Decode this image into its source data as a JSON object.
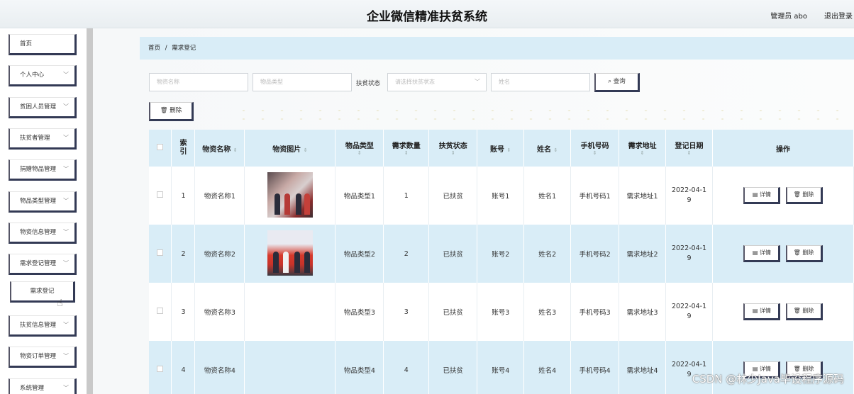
{
  "header": {
    "title": "企业微信精准扶贫系统",
    "user": "管理员 abo",
    "logout": "退出登录"
  },
  "sidebar": {
    "items": [
      {
        "label": "首页",
        "has_chevron": false
      },
      {
        "label": "个人中心",
        "has_chevron": true
      },
      {
        "label": "贫困人员管理",
        "has_chevron": true
      },
      {
        "label": "扶贫者管理",
        "has_chevron": true
      },
      {
        "label": "捐赠物品管理",
        "has_chevron": true
      },
      {
        "label": "物品类型管理",
        "has_chevron": true
      },
      {
        "label": "物资信息管理",
        "has_chevron": true
      },
      {
        "label": "需求登记管理",
        "has_chevron": true
      },
      {
        "label": "需求登记",
        "has_chevron": false
      },
      {
        "label": "扶贫信息管理",
        "has_chevron": true
      },
      {
        "label": "物资订单管理",
        "has_chevron": true
      },
      {
        "label": "系统管理",
        "has_chevron": true
      }
    ],
    "chevron": "﹀"
  },
  "breadcrumb": {
    "home": "首页",
    "separator": "/",
    "current": "需求登记"
  },
  "search": {
    "name_placeholder": "物资名称",
    "type_placeholder": "物品类型",
    "status_label": "扶贫状态",
    "status_placeholder": "请选择扶贫状态",
    "person_placeholder": "姓名",
    "search_button": "查询",
    "search_icon": "⌕"
  },
  "toolbar": {
    "delete_button": "删除",
    "delete_icon": "🗑"
  },
  "table": {
    "columns": [
      "索引",
      "物资名称",
      "物资图片",
      "物品类型",
      "需求数量",
      "扶贫状态",
      "账号",
      "姓名",
      "手机号码",
      "需求地址",
      "登记日期",
      "操作"
    ],
    "sort_icon": "⇕",
    "rows": [
      {
        "index": "1",
        "name": "物资名称1",
        "type": "物品类型1",
        "qty": "1",
        "status": "已扶贫",
        "account": "账号1",
        "person": "姓名1",
        "phone": "手机号码1",
        "address": "需求地址1",
        "date_a": "2022-04-1",
        "date_b": "9",
        "has_image": true
      },
      {
        "index": "2",
        "name": "物资名称2",
        "type": "物品类型2",
        "qty": "2",
        "status": "已扶贫",
        "account": "账号2",
        "person": "姓名2",
        "phone": "手机号码2",
        "address": "需求地址2",
        "date_a": "2022-04-1",
        "date_b": "9",
        "has_image": true
      },
      {
        "index": "3",
        "name": "物资名称3",
        "type": "物品类型3",
        "qty": "3",
        "status": "已扶贫",
        "account": "账号3",
        "person": "姓名3",
        "phone": "手机号码3",
        "address": "需求地址3",
        "date_a": "2022-04-1",
        "date_b": "9",
        "has_image": false
      },
      {
        "index": "4",
        "name": "物资名称4",
        "type": "物品类型4",
        "qty": "4",
        "status": "已扶贫",
        "account": "账号4",
        "person": "姓名4",
        "phone": "手机号码4",
        "address": "需求地址4",
        "date_a": "2022-04-1",
        "date_b": "9",
        "has_image": false
      }
    ],
    "detail_button": "详情",
    "delete_button": "删除",
    "detail_icon": "▤",
    "delete_icon": "🗑"
  },
  "watermark": "CSDN @林少Java毕设程序源码",
  "colors": {
    "accent_row": "#d9edf7",
    "button_shadow": "#333a55"
  }
}
